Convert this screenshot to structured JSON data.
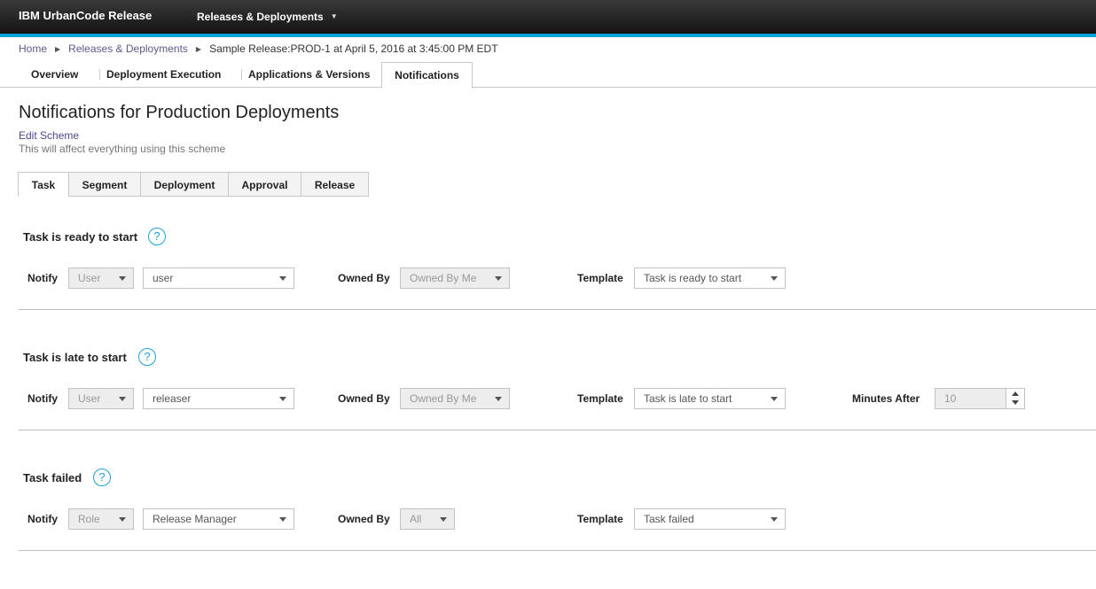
{
  "app": {
    "brand": "IBM UrbanCode Release",
    "menu": "Releases & Deployments"
  },
  "breadcrumb": {
    "home": "Home",
    "section": "Releases & Deployments",
    "current": "Sample Release:PROD-1 at April 5, 2016 at 3:45:00 PM EDT"
  },
  "main_tabs": [
    "Overview",
    "Deployment Execution",
    "Applications & Versions",
    "Notifications"
  ],
  "page": {
    "title": "Notifications for Production Deployments",
    "edit_link": "Edit Scheme",
    "edit_note": "This will affect everything using this scheme"
  },
  "sub_tabs": [
    "Task",
    "Segment",
    "Deployment",
    "Approval",
    "Release"
  ],
  "labels": {
    "notify": "Notify",
    "owned_by": "Owned By",
    "template": "Template",
    "minutes_after": "Minutes After",
    "help": "?"
  },
  "sections": [
    {
      "title": "Task is ready to start",
      "notify_type": "User",
      "notify_target": "user",
      "owned_by": "Owned By Me",
      "template": "Task is ready to start"
    },
    {
      "title": "Task is late to start",
      "notify_type": "User",
      "notify_target": "releaser",
      "owned_by": "Owned By Me",
      "template": "Task is late to start",
      "minutes_after": "10"
    },
    {
      "title": "Task failed",
      "notify_type": "Role",
      "notify_target": "Release Manager",
      "owned_by": "All",
      "template": "Task failed"
    }
  ],
  "colors": {
    "accent": "#00a6d6",
    "help": "#1ea0d8"
  }
}
